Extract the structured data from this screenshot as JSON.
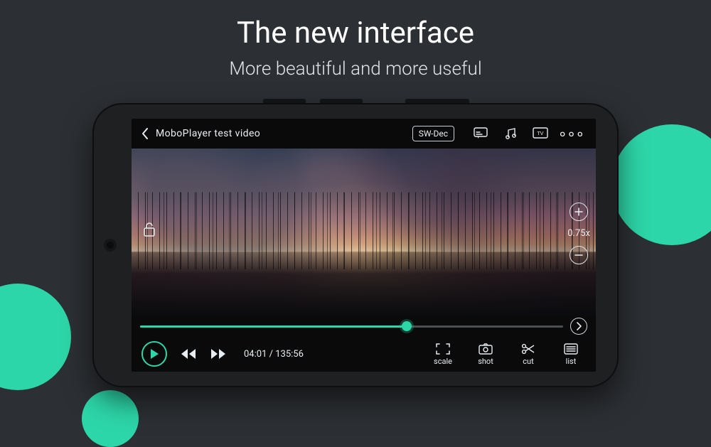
{
  "promo": {
    "headline": "The new interface",
    "subhead": "More beautiful and more useful"
  },
  "player": {
    "title": "MoboPlayer test video",
    "decoder_label": "SW-Dec",
    "time_current": "04:01",
    "time_total": "135:56",
    "time_sep": " / ",
    "zoom_value": "0.75x",
    "progress_pct": 63,
    "tools": {
      "scale": "scale",
      "shot": "shot",
      "cut": "cut",
      "list": "list"
    }
  },
  "icons": {
    "back": "chevron-left-icon",
    "subtitle": "subtitle-icon",
    "music": "music-icon",
    "tv": "tv-icon",
    "more": "more-icon",
    "lock": "lock-open-icon",
    "zoom_in": "zoom-in-icon",
    "zoom_out": "zoom-out-icon",
    "next": "chevron-right-icon",
    "play": "play-icon",
    "rewind": "rewind-icon",
    "forward": "forward-icon",
    "scale": "scale-icon",
    "shot": "camera-icon",
    "cut": "scissors-icon",
    "list": "list-icon"
  },
  "colors": {
    "accent": "#2dd6a8",
    "bg": "#2c2f33"
  }
}
